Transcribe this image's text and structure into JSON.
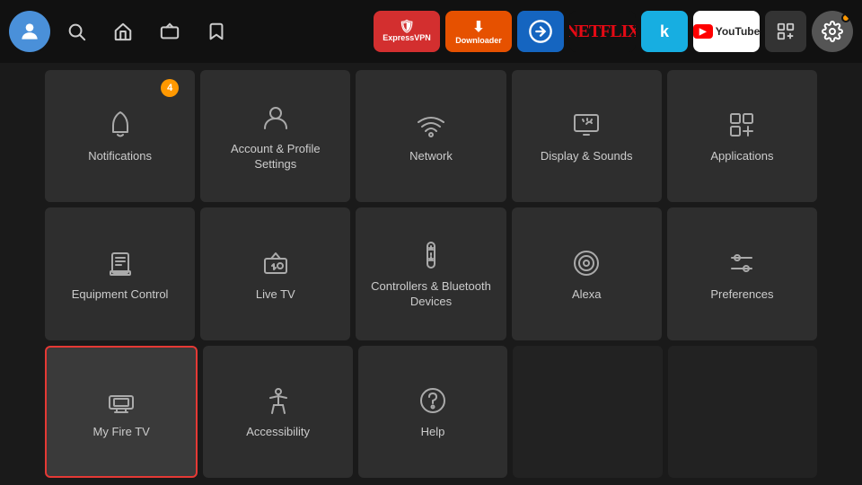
{
  "topbar": {
    "avatar_icon": "👤",
    "nav_items": [
      {
        "name": "search-icon",
        "icon": "🔍"
      },
      {
        "name": "home-icon",
        "icon": "🏠"
      },
      {
        "name": "tv-icon",
        "icon": "📺"
      },
      {
        "name": "bookmark-icon",
        "icon": "🔖"
      }
    ],
    "apps": [
      {
        "name": "expressvpn-icon",
        "label": "Express VPN",
        "style": "expressvpn"
      },
      {
        "name": "downloader-icon",
        "label": "⬇ Downloader",
        "style": "downloader"
      },
      {
        "name": "fcloud-icon",
        "label": "☁",
        "style": "fcloud"
      },
      {
        "name": "netflix-icon",
        "label": "NETFLIX",
        "style": "netflix"
      },
      {
        "name": "kodi-icon",
        "label": "⬡",
        "style": "kodi"
      },
      {
        "name": "youtube-icon",
        "label": "YouTube",
        "style": "youtube"
      },
      {
        "name": "appgrid-icon",
        "label": "⊞",
        "style": "appgrid"
      },
      {
        "name": "settings-icon",
        "label": "⚙",
        "style": "settings"
      }
    ]
  },
  "grid": {
    "rows": [
      [
        {
          "name": "notifications",
          "label": "Notifications",
          "badge": "4"
        },
        {
          "name": "account-profile",
          "label": "Account & Profile Settings"
        },
        {
          "name": "network",
          "label": "Network"
        },
        {
          "name": "display-sounds",
          "label": "Display & Sounds"
        },
        {
          "name": "applications",
          "label": "Applications"
        }
      ],
      [
        {
          "name": "equipment-control",
          "label": "Equipment Control"
        },
        {
          "name": "live-tv",
          "label": "Live TV"
        },
        {
          "name": "controllers-bluetooth",
          "label": "Controllers & Bluetooth Devices"
        },
        {
          "name": "alexa",
          "label": "Alexa"
        },
        {
          "name": "preferences",
          "label": "Preferences"
        }
      ],
      [
        {
          "name": "my-fire-tv",
          "label": "My Fire TV",
          "selected": true
        },
        {
          "name": "accessibility",
          "label": "Accessibility"
        },
        {
          "name": "help",
          "label": "Help"
        },
        {
          "name": "empty-1",
          "label": "",
          "empty": true
        },
        {
          "name": "empty-2",
          "label": "",
          "empty": true
        }
      ]
    ]
  }
}
